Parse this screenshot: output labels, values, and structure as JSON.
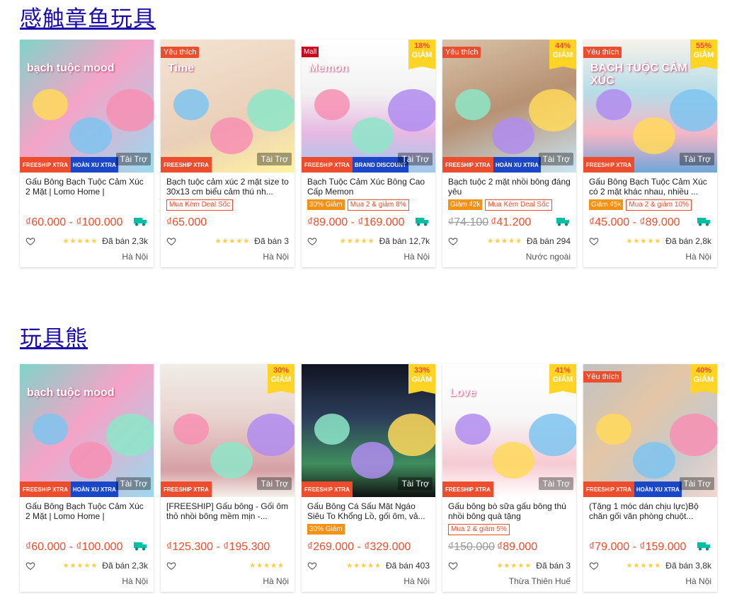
{
  "sections": [
    {
      "title": "感触章鱼玩具",
      "products": [
        {
          "name": "Gấu Bông Bạch Tuộc Cảm Xúc 2 Mặt | Lomo Home |",
          "price": "₫60.000 - ₫100.000",
          "old_price": "",
          "promos": [],
          "sold": "Đã bán 2,3k",
          "location": "Hà Nội",
          "tag": "",
          "discount": "",
          "sponsor": "Tài Trợ",
          "freeship": "FREESHIP XTRA",
          "hoan_xu": "HOÀN XU XTRA",
          "thumb_text": "bạch tuộc mood",
          "has_truck": true
        },
        {
          "name": "Bạch tuộc cảm xúc 2 mặt size to 30x13 cm biểu cảm thú nh...",
          "price": "₫65.000",
          "old_price": "",
          "promos": [
            {
              "text": "Mua Kèm Deal Sốc",
              "filled": false
            }
          ],
          "sold": "Đã bán 3",
          "location": "Hà Nội",
          "tag": "Yêu thích",
          "discount": "",
          "sponsor": "Tài Trợ",
          "freeship": "FREESHIP XTRA",
          "hoan_xu": "",
          "thumb_text": "Time",
          "has_truck": false
        },
        {
          "name": "Bạch Tuộc Cảm Xúc Bông Cao Cấp Memon",
          "price": "₫89.000 - ₫169.000",
          "old_price": "",
          "promos": [
            {
              "text": "30% Giảm",
              "filled": true
            },
            {
              "text": "Mua 2 & giảm 8%",
              "filled": false
            }
          ],
          "sold": "Đã bán 12,7k",
          "location": "Hà Nội",
          "tag": "Mall",
          "discount": "18%",
          "discount_label": "GIẢM",
          "sponsor": "Tài Trợ",
          "freeship": "FREESHIP XTRA",
          "hoan_xu": "BRAND DISCOUNT",
          "thumb_text": "Memon",
          "has_truck": true
        },
        {
          "name": "Bạch tuộc 2 mặt nhồi bông đáng yêu",
          "price": "₫41.200",
          "old_price": "₫74.100",
          "promos": [
            {
              "text": "Giảm ₫2k",
              "filled": true
            },
            {
              "text": "Mua Kèm Deal Sốc",
              "filled": false
            }
          ],
          "sold": "Đã bán 294",
          "location": "Nước ngoài",
          "tag": "Yêu thích",
          "discount": "44%",
          "discount_label": "GIẢM",
          "sponsor": "Tài Trợ",
          "freeship": "FREESHIP XTRA",
          "hoan_xu": "HOÀN XU XTRA",
          "thumb_text": "",
          "has_truck": true
        },
        {
          "name": "Gấu Bông Bạch Tuộc Cảm Xúc có 2 mặt khác nhau, nhiều ...",
          "price": "₫45.000 - ₫89.000",
          "old_price": "",
          "promos": [
            {
              "text": "Giảm ₫5k",
              "filled": true
            },
            {
              "text": "Mua 2 & giảm 10%",
              "filled": false
            }
          ],
          "sold": "Đã bán 2,8k",
          "location": "Hà Nội",
          "tag": "Yêu thích",
          "discount": "55%",
          "discount_label": "GIẢM",
          "sponsor": "Tài Trợ",
          "freeship": "FREESHIP XTRA",
          "hoan_xu": "",
          "thumb_text": "BẠCH TUỘC CẢM XÚC",
          "has_truck": true
        }
      ]
    },
    {
      "title": "玩具熊",
      "products": [
        {
          "name": "Gấu Bông Bạch Tuộc Cảm Xúc 2 Mặt | Lomo Home |",
          "price": "₫60.000 - ₫100.000",
          "old_price": "",
          "promos": [],
          "sold": "Đã bán 2,3k",
          "location": "Hà Nội",
          "tag": "",
          "discount": "",
          "sponsor": "Tài Trợ",
          "freeship": "FREESHIP XTRA",
          "hoan_xu": "HOÀN XU XTRA",
          "thumb_text": "bạch tuộc mood",
          "has_truck": true
        },
        {
          "name": "[FREESHIP] Gấu bông - Gối ôm thỏ nhồi bông mềm mịn -...",
          "price": "₫125.300 - ₫195.300",
          "old_price": "",
          "promos": [],
          "sold": "",
          "location": "Hà Nội",
          "tag": "",
          "discount": "30%",
          "discount_label": "GIẢM",
          "sponsor": "Tài Trợ",
          "freeship": "FREESHIP XTRA",
          "hoan_xu": "",
          "thumb_text": "",
          "has_truck": false
        },
        {
          "name": "Gấu Bông Cá Sấu Mặt Ngáo Siêu To Khổng Lồ, gối ôm, vả...",
          "price": "₫269.000 - ₫329.000",
          "old_price": "",
          "promos": [
            {
              "text": "30% Giảm",
              "filled": true
            }
          ],
          "sold": "Đã bán 403",
          "location": "Hà Nội",
          "tag": "",
          "discount": "33%",
          "discount_label": "GIẢM",
          "sponsor": "Tài Trợ",
          "freeship": "FREESHIP XTRA",
          "hoan_xu": "",
          "thumb_text": "",
          "has_truck": false
        },
        {
          "name": "Gấu bông bò sữa gấu bông thú nhồi bông quà tặng",
          "price": "₫89.000",
          "old_price": "₫150.000",
          "promos": [
            {
              "text": "Mua 2 & giảm 5%",
              "filled": false
            }
          ],
          "sold": "Đã bán 3",
          "location": "Thừa Thiên Huế",
          "tag": "",
          "discount": "41%",
          "discount_label": "GIẢM",
          "sponsor": "Tài Trợ",
          "freeship": "FREESHIP XTRA",
          "hoan_xu": "",
          "thumb_text": "Love",
          "has_truck": false
        },
        {
          "name": "(Tặng 1 móc dán chịu lực)Bộ chăn gối văn phòng chuột...",
          "price": "₫79.000 - ₫159.000",
          "old_price": "",
          "promos": [],
          "sold": "Đã bán 3,8k",
          "location": "Hà Nội",
          "tag": "Yêu thích",
          "discount": "40%",
          "discount_label": "GIẢM",
          "sponsor": "Tài Trợ",
          "freeship": "FREESHIP XTRA",
          "hoan_xu": "HOÀN XU XTRA",
          "thumb_text": "",
          "has_truck": true
        }
      ]
    }
  ],
  "colors": {
    "accent": "#ee4d2d",
    "link": "#1a0dab",
    "star": "#ffce3d",
    "discount_bg": "#ffd424",
    "truck": "#00bfa5"
  },
  "icons": {
    "heart": "heart-icon",
    "truck": "truck-icon",
    "star": "star-icon"
  }
}
